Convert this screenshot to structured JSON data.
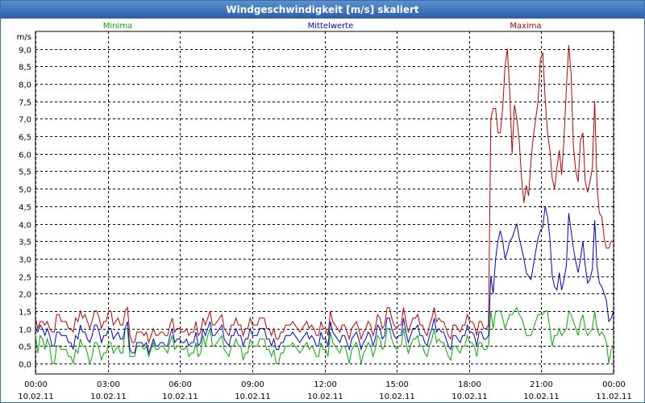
{
  "window": {
    "title": "Windgeschwindigkeit [m/s] skaliert"
  },
  "chart_data": {
    "type": "line",
    "title": "Windgeschwindigkeit [m/s] skaliert",
    "y_unit": "m/s",
    "ylim": [
      -0.3,
      9.5
    ],
    "y_ticks": [
      "0,0",
      "0,5",
      "1,0",
      "1,5",
      "2,0",
      "2,5",
      "3,0",
      "3,5",
      "4,0",
      "4,5",
      "5,0",
      "5,5",
      "6,0",
      "6,5",
      "7,0",
      "7,5",
      "8,0",
      "8,5",
      "9,0"
    ],
    "x_ticks": [
      {
        "time": "00:00",
        "date": "10.02.11"
      },
      {
        "time": "03:00",
        "date": "10.02.11"
      },
      {
        "time": "06:00",
        "date": "10.02.11"
      },
      {
        "time": "09:00",
        "date": "10.02.11"
      },
      {
        "time": "12:00",
        "date": "10.02.11"
      },
      {
        "time": "15:00",
        "date": "10.02.11"
      },
      {
        "time": "18:00",
        "date": "10.02.11"
      },
      {
        "time": "21:00",
        "date": "10.02.11"
      },
      {
        "time": "00:00",
        "date": "11.02.11"
      }
    ],
    "grid": true,
    "legend_position": "top",
    "x_hours_start": 0,
    "x_hours_end": 24,
    "series": [
      {
        "name": "Minima",
        "color": "#00aa00",
        "values": [
          0.8,
          0.3,
          0.8,
          0.7,
          0.4,
          0.7,
          0.5,
          0.0,
          0.0,
          0.5,
          0.5,
          0.4,
          0.4,
          0.4,
          0.2,
          0.2,
          0.0,
          0.4,
          0.3,
          0.7,
          0.5,
          0.5,
          0.3,
          0.0,
          0.2,
          0.6,
          0.6,
          0.4,
          0.1,
          0.3,
          0.3,
          0.6,
          0.6,
          0.3,
          0.4,
          0.5,
          0.3,
          0.3,
          1.0,
          1.0,
          0.2,
          0.2,
          0.2,
          0.5,
          0.5,
          0.5,
          0.4,
          0.5,
          0.2,
          0.4,
          0.6,
          0.4,
          0.4,
          0.5,
          0.5,
          0.4,
          0.3,
          0.6,
          0.8,
          0.4,
          0.5,
          0.5,
          0.4,
          0.4,
          0.5,
          0.2,
          0.3,
          0.3,
          0.6,
          0.2,
          0.3,
          0.8,
          0.5,
          0.8,
          1.0,
          0.5,
          0.5,
          0.6,
          0.7,
          0.8,
          0.4,
          0.3,
          0.2,
          0.5,
          0.5,
          0.7,
          0.5,
          0.5,
          0.1,
          0.3,
          0.3,
          0.7,
          0.5,
          0.5,
          0.5,
          0.7,
          0.7,
          0.7,
          0.4,
          0.4,
          0.2,
          0.4,
          0.0,
          0.0,
          0.3,
          0.3,
          0.5,
          0.5,
          0.5,
          0.6,
          0.5,
          0.4,
          0.3,
          0.4,
          0.5,
          0.6,
          0.4,
          0.5,
          0.4,
          0.2,
          0.2,
          0.6,
          0.4,
          0.4,
          0.2,
          0.9,
          0.6,
          0.5,
          0.4,
          0.3,
          0.5,
          0.5,
          0.3,
          0.0,
          0.4,
          0.5,
          0.6,
          0.4,
          0.0,
          0.3,
          0.4,
          0.6,
          0.5,
          0.2,
          0.4,
          0.8,
          0.7,
          0.4,
          0.5,
          1.0,
          1.0,
          0.7,
          0.5,
          0.4,
          0.5,
          0.5,
          1.0,
          0.6,
          0.3,
          0.5,
          0.7,
          0.7,
          0.8,
          0.5,
          0.5,
          0.3,
          0.2,
          0.5,
          0.7,
          1.0,
          0.6,
          0.7,
          0.6,
          0.6,
          0.4,
          0.2,
          0.1,
          0.5,
          0.5,
          0.4,
          0.3,
          0.5,
          0.5,
          0.8,
          0.6,
          0.6,
          0.5,
          0.2,
          0.6,
          0.6,
          0.4,
          0.4,
          0.5,
          1.5,
          1.0,
          1.5,
          1.5,
          1.5,
          1.3,
          1.0,
          1.2,
          1.4,
          1.4,
          1.5,
          1.6,
          1.4,
          1.3,
          1.1,
          0.8,
          0.8,
          0.8,
          1.0,
          1.2,
          1.4,
          1.4,
          1.4,
          1.5,
          1.5,
          1.0,
          0.5,
          0.8,
          0.8,
          1.0,
          0.8,
          0.9,
          1.0,
          1.5,
          1.4,
          1.2,
          1.0,
          0.8,
          1.2,
          1.4,
          1.0,
          0.8,
          0.9,
          1.0,
          1.5,
          1.0,
          0.8,
          0.9,
          0.8,
          0.6,
          0.0,
          0.4,
          0.5
        ]
      },
      {
        "name": "Mittelwerte",
        "color": "#0000cc",
        "values": [
          1.0,
          0.9,
          1.1,
          1.0,
          0.8,
          1.0,
          0.8,
          0.5,
          0.5,
          0.9,
          0.9,
          0.8,
          0.8,
          0.8,
          0.6,
          0.6,
          0.4,
          0.8,
          0.7,
          1.1,
          0.9,
          0.9,
          0.7,
          0.6,
          0.8,
          1.1,
          1.1,
          0.9,
          0.6,
          0.8,
          0.8,
          1.0,
          1.0,
          0.7,
          0.8,
          0.9,
          0.7,
          0.7,
          1.0,
          1.2,
          0.4,
          0.3,
          0.3,
          0.6,
          0.6,
          0.6,
          0.5,
          0.6,
          0.3,
          0.5,
          0.7,
          0.5,
          0.5,
          0.6,
          0.6,
          0.5,
          0.5,
          0.8,
          1.0,
          0.6,
          0.7,
          0.7,
          0.6,
          0.6,
          0.7,
          0.5,
          0.6,
          0.6,
          0.9,
          0.5,
          0.6,
          1.0,
          0.8,
          1.0,
          1.2,
          0.8,
          0.8,
          0.9,
          1.0,
          1.1,
          0.7,
          0.6,
          0.5,
          0.8,
          0.8,
          1.0,
          0.8,
          0.8,
          0.5,
          0.7,
          0.7,
          1.0,
          0.8,
          0.8,
          0.8,
          1.0,
          1.0,
          1.0,
          0.7,
          0.7,
          0.5,
          0.7,
          0.4,
          0.4,
          0.6,
          0.6,
          0.8,
          0.8,
          0.8,
          0.9,
          0.8,
          0.7,
          0.6,
          0.7,
          0.8,
          0.9,
          0.7,
          0.8,
          0.7,
          0.5,
          0.5,
          0.9,
          0.7,
          0.7,
          0.5,
          1.2,
          0.9,
          0.8,
          0.7,
          0.6,
          0.8,
          0.8,
          0.6,
          0.4,
          0.7,
          0.8,
          0.9,
          0.7,
          0.4,
          0.6,
          0.7,
          0.9,
          0.8,
          0.5,
          0.7,
          1.1,
          1.0,
          0.7,
          0.8,
          1.3,
          1.3,
          1.0,
          0.8,
          0.7,
          0.8,
          0.8,
          1.3,
          0.9,
          0.6,
          0.8,
          1.0,
          1.0,
          1.1,
          0.8,
          0.8,
          0.6,
          0.5,
          0.8,
          1.0,
          1.3,
          0.9,
          1.0,
          0.9,
          0.9,
          0.7,
          0.5,
          0.4,
          0.8,
          0.8,
          0.7,
          0.6,
          0.8,
          0.8,
          1.1,
          0.9,
          0.9,
          0.8,
          0.5,
          0.9,
          0.9,
          0.7,
          0.7,
          0.8,
          2.5,
          2.0,
          3.0,
          3.5,
          3.8,
          3.5,
          3.0,
          3.2,
          3.5,
          3.6,
          3.8,
          4.0,
          3.6,
          3.3,
          3.0,
          2.6,
          2.5,
          2.4,
          2.8,
          3.2,
          3.6,
          3.8,
          3.9,
          4.5,
          4.2,
          3.6,
          2.5,
          2.2,
          2.1,
          2.6,
          2.1,
          2.4,
          2.8,
          4.3,
          3.8,
          3.3,
          2.9,
          2.6,
          3.0,
          3.5,
          2.8,
          2.3,
          2.4,
          2.7,
          4.1,
          2.8,
          2.3,
          2.2,
          2.0,
          1.8,
          1.2,
          1.3,
          1.5
        ]
      },
      {
        "name": "Maxima",
        "color": "#bb0000",
        "values": [
          1.3,
          1.0,
          1.2,
          1.2,
          1.1,
          1.2,
          1.0,
          0.9,
          0.9,
          1.4,
          1.4,
          1.2,
          1.2,
          1.2,
          1.0,
          1.0,
          0.9,
          1.3,
          1.2,
          1.5,
          1.3,
          1.4,
          1.2,
          1.0,
          1.2,
          1.5,
          1.5,
          1.3,
          1.0,
          1.2,
          1.2,
          1.5,
          1.5,
          1.1,
          1.2,
          1.3,
          1.1,
          1.1,
          1.5,
          1.6,
          0.8,
          0.6,
          0.6,
          0.9,
          0.9,
          0.9,
          0.8,
          0.9,
          0.6,
          0.8,
          1.0,
          0.8,
          0.8,
          0.9,
          0.9,
          0.8,
          0.8,
          1.1,
          1.3,
          0.9,
          1.0,
          1.0,
          0.9,
          0.9,
          1.0,
          0.8,
          0.9,
          0.9,
          1.2,
          0.8,
          0.9,
          1.3,
          1.1,
          1.3,
          1.5,
          1.1,
          1.1,
          1.2,
          1.3,
          1.4,
          1.0,
          0.9,
          0.8,
          1.1,
          1.1,
          1.3,
          1.1,
          1.1,
          0.8,
          1.0,
          1.0,
          1.3,
          1.1,
          1.1,
          1.1,
          1.3,
          1.3,
          1.3,
          1.0,
          1.0,
          0.8,
          1.0,
          0.7,
          0.7,
          0.9,
          0.9,
          1.1,
          1.1,
          1.1,
          1.2,
          1.1,
          1.0,
          0.9,
          1.0,
          1.1,
          1.2,
          1.0,
          1.1,
          1.0,
          0.8,
          0.8,
          1.2,
          1.0,
          1.0,
          0.8,
          1.5,
          1.2,
          1.1,
          1.0,
          0.9,
          1.1,
          1.1,
          0.9,
          0.7,
          1.0,
          1.1,
          1.2,
          1.0,
          0.7,
          0.9,
          1.0,
          1.2,
          1.1,
          0.8,
          1.0,
          1.4,
          1.3,
          1.0,
          1.1,
          1.6,
          1.6,
          1.3,
          1.1,
          1.0,
          1.1,
          1.1,
          1.6,
          1.2,
          0.9,
          1.1,
          1.3,
          1.3,
          1.4,
          1.1,
          1.1,
          0.9,
          0.8,
          1.1,
          1.3,
          1.6,
          1.2,
          1.3,
          1.2,
          1.2,
          1.0,
          0.8,
          0.7,
          1.1,
          1.1,
          1.0,
          0.9,
          1.1,
          1.1,
          1.4,
          1.2,
          1.2,
          1.1,
          0.8,
          1.2,
          1.2,
          1.0,
          1.0,
          1.1,
          7.0,
          7.3,
          7.3,
          6.6,
          6.6,
          7.3,
          8.5,
          9.0,
          7.8,
          6.0,
          7.4,
          7.0,
          6.4,
          5.3,
          4.6,
          5.1,
          4.8,
          5.8,
          6.5,
          7.0,
          7.5,
          8.7,
          8.9,
          7.6,
          6.6,
          6.1,
          5.3,
          5.0,
          5.6,
          6.1,
          5.4,
          6.4,
          7.9,
          9.1,
          8.3,
          6.2,
          5.5,
          5.2,
          6.4,
          6.6,
          5.2,
          4.9,
          5.2,
          5.6,
          7.5,
          5.1,
          4.3,
          4.2,
          3.6,
          3.3,
          3.3,
          3.5,
          3.5
        ]
      }
    ]
  }
}
